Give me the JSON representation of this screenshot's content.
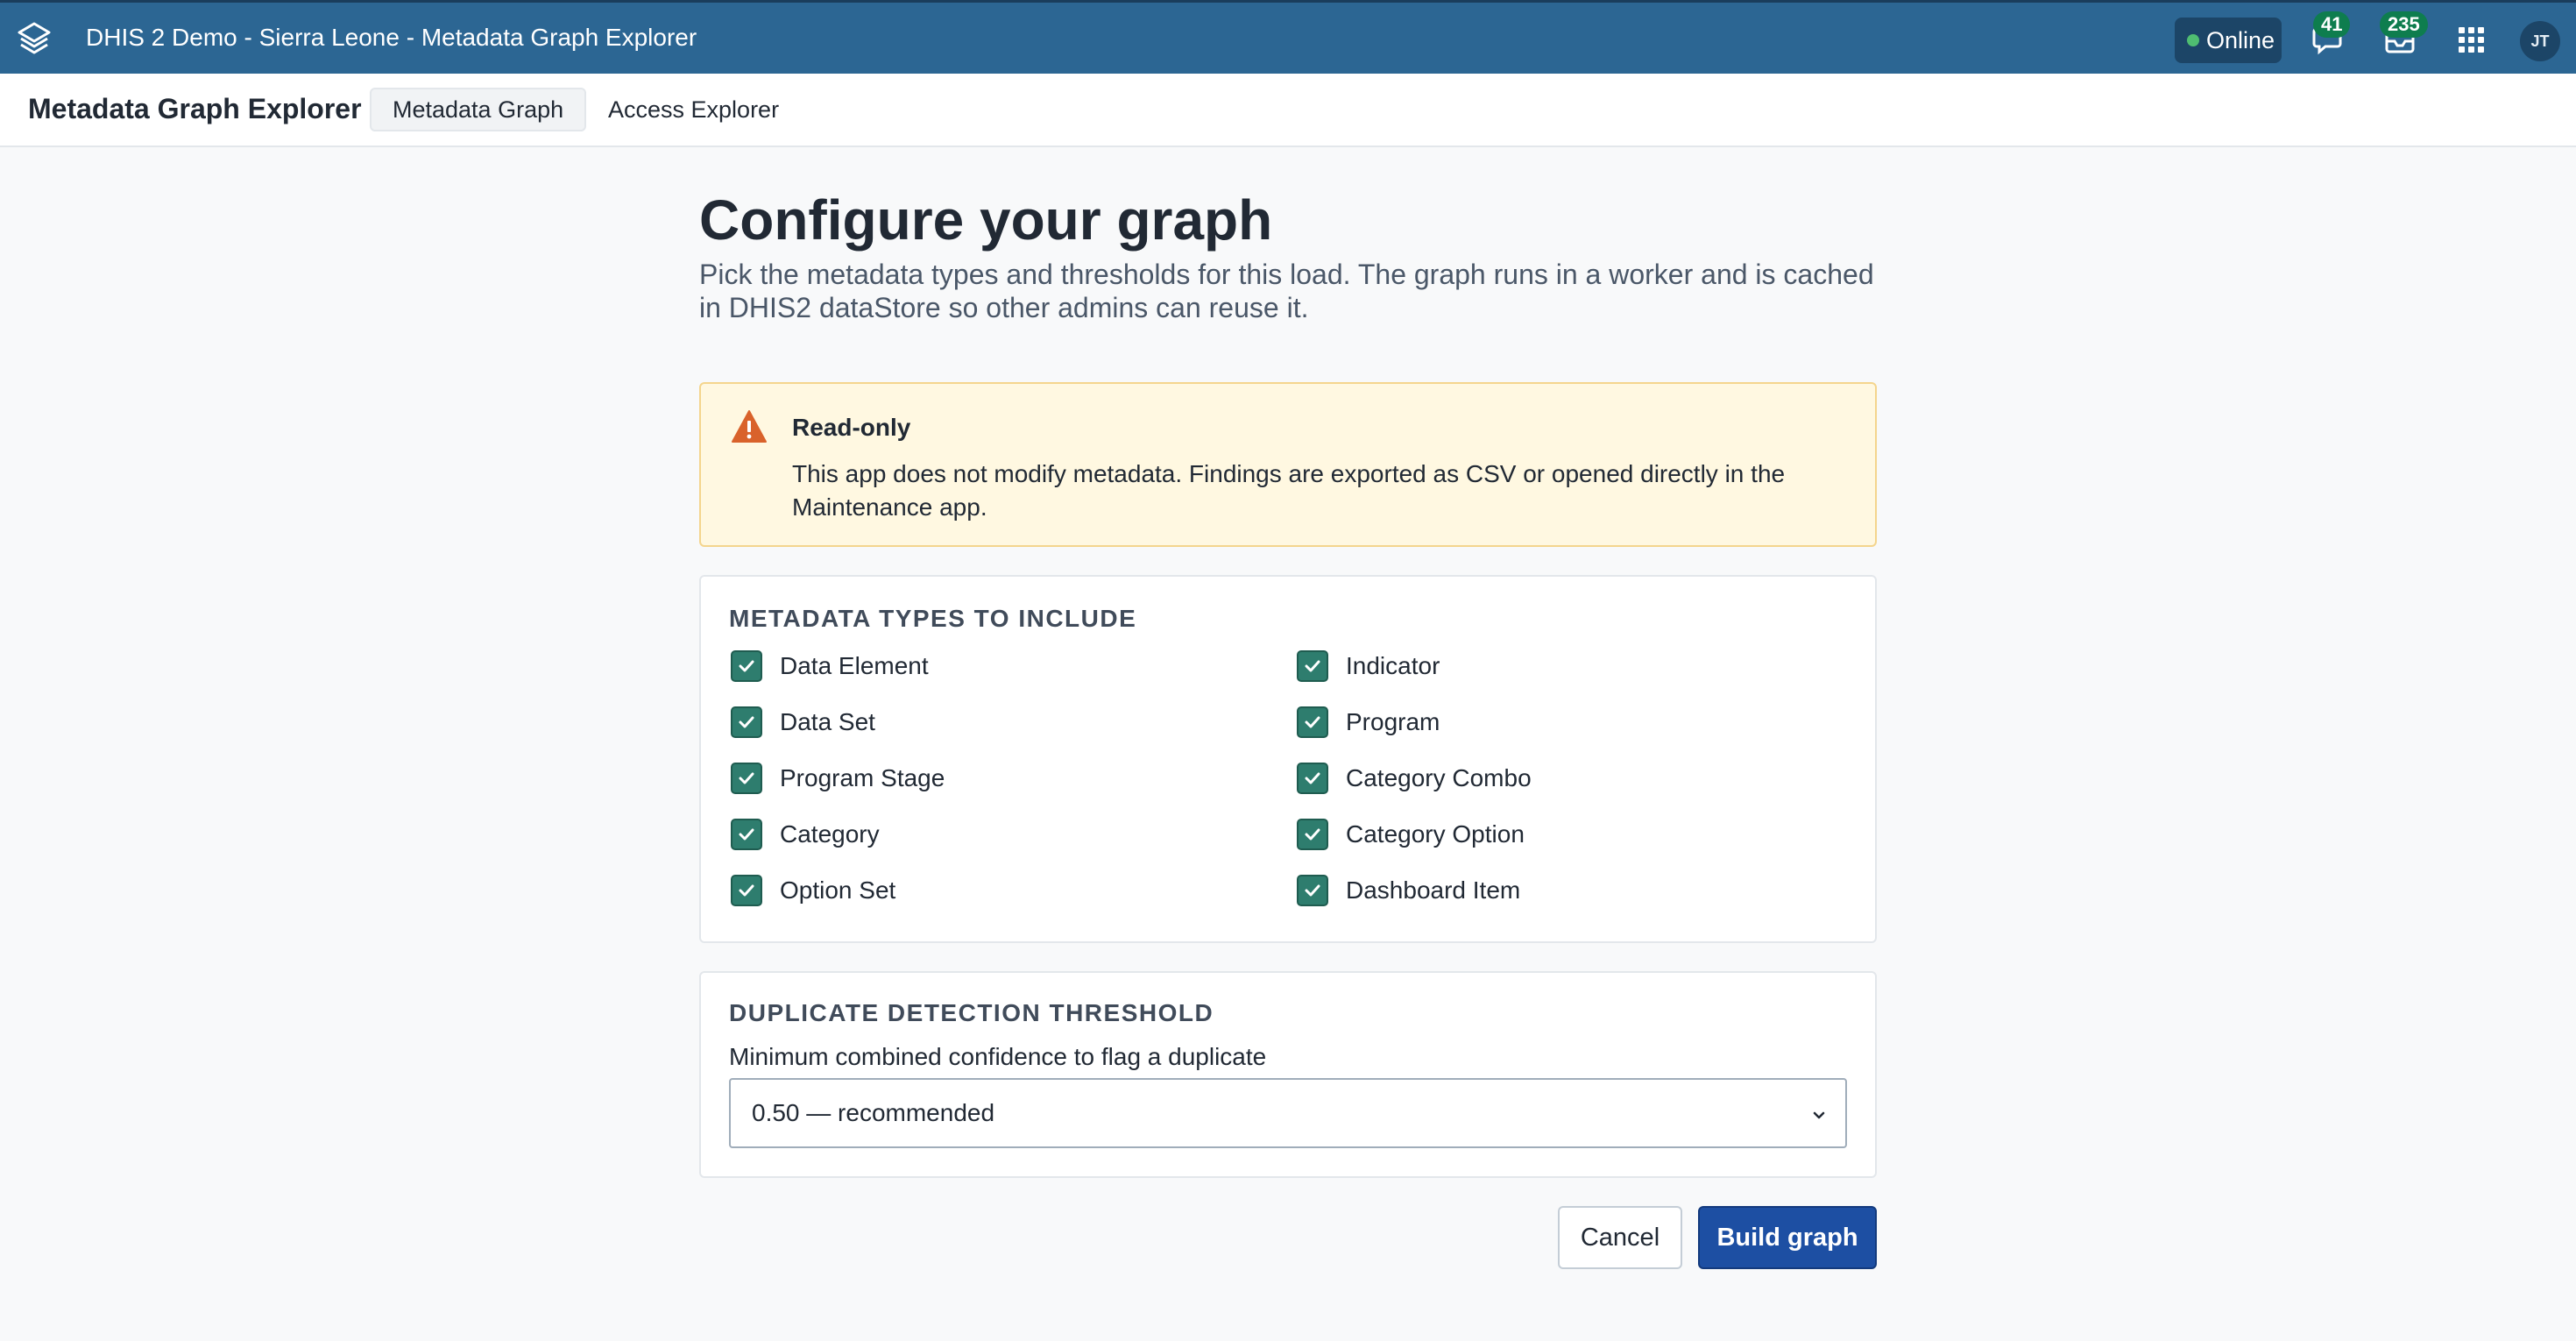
{
  "header": {
    "title": "DHIS 2 Demo - Sierra Leone - Metadata Graph Explorer",
    "status": "Online",
    "messages_count": "41",
    "interpretations_count": "235",
    "user_initials": "JT"
  },
  "subnav": {
    "app_title": "Metadata Graph Explorer",
    "tabs": [
      {
        "label": "Metadata Graph",
        "active": true
      },
      {
        "label": "Access Explorer",
        "active": false
      }
    ]
  },
  "main": {
    "title": "Configure your graph",
    "description": "Pick the metadata types and thresholds for this load. The graph runs in a worker and is cached in DHIS2 dataStore so other admins can reuse it.",
    "alert": {
      "title": "Read-only",
      "body": "This app does not modify metadata. Findings are exported as CSV or opened directly in the Maintenance app."
    },
    "metadata_types": {
      "heading": "METADATA TYPES TO INCLUDE",
      "items": [
        {
          "label": "Data Element",
          "checked": true
        },
        {
          "label": "Indicator",
          "checked": true
        },
        {
          "label": "Data Set",
          "checked": true
        },
        {
          "label": "Program",
          "checked": true
        },
        {
          "label": "Program Stage",
          "checked": true
        },
        {
          "label": "Category Combo",
          "checked": true
        },
        {
          "label": "Category",
          "checked": true
        },
        {
          "label": "Category Option",
          "checked": true
        },
        {
          "label": "Option Set",
          "checked": true
        },
        {
          "label": "Dashboard Item",
          "checked": true
        }
      ]
    },
    "threshold": {
      "heading": "DUPLICATE DETECTION THRESHOLD",
      "label": "Minimum combined confidence to flag a duplicate",
      "selected": "0.50 — recommended"
    },
    "actions": {
      "cancel": "Cancel",
      "build": "Build graph"
    }
  },
  "colors": {
    "header_bg": "#2c6693",
    "primary_button": "#1d4fa3",
    "checkbox": "#2e7d6e",
    "alert_bg": "#fff8e1",
    "warning_icon": "#d9622b",
    "online_dot": "#4fbd71"
  },
  "icons": {
    "logo": "dhis2-logo-icon",
    "messages": "messages-icon",
    "interpretations": "interpretations-icon",
    "apps": "apps-grid-icon",
    "warning": "warning-icon",
    "checkbox": "checkmark-icon",
    "select": "chevron-down-icon"
  }
}
